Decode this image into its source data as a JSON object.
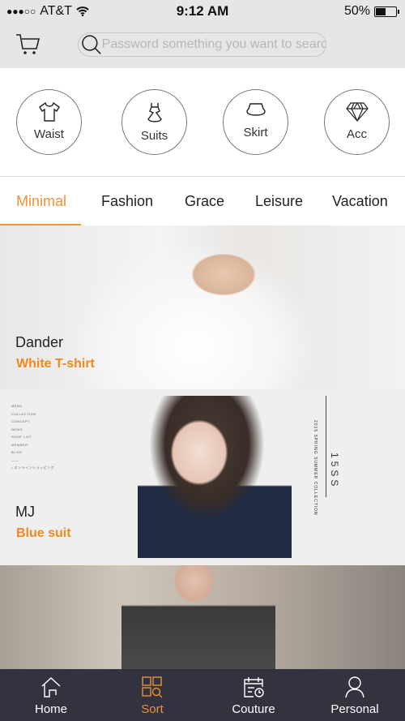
{
  "status_bar": {
    "signal": "●●●○○",
    "carrier": "AT&T",
    "time": "9:12 AM",
    "battery": "50%",
    "battery_level": 0.5
  },
  "header": {
    "search_placeholder": "Password something you want to search",
    "icons": [
      "cart-icon",
      "search-icon"
    ]
  },
  "categories": [
    {
      "label": "Waist",
      "icon": "tshirt-icon"
    },
    {
      "label": "Suits",
      "icon": "dress-icon"
    },
    {
      "label": "Skirt",
      "icon": "skirt-icon"
    },
    {
      "label": "Acc",
      "icon": "diamond-icon"
    }
  ],
  "tabs": [
    {
      "label": "Minimal",
      "active": true
    },
    {
      "label": "Fashion"
    },
    {
      "label": "Grace"
    },
    {
      "label": "Leisure"
    },
    {
      "label": "Vacation"
    }
  ],
  "banners": [
    {
      "title": "Dander",
      "subtitle": "White T-shirt"
    },
    {
      "title": "MJ",
      "subtitle": "Blue suit",
      "side_menu": [
        "MENU",
        "COLLECTION",
        "CONCEPT",
        "NEWS",
        "SHOP LIST",
        "MEMBER",
        "BLOG"
      ],
      "side_link": "• オンラインショッピング",
      "vertical_text": "2015 SPRING SUMMER COLLECTION",
      "collection_code": "15SS"
    },
    {}
  ],
  "bottom_nav": [
    {
      "label": "Home",
      "icon": "home-icon"
    },
    {
      "label": "Sort",
      "icon": "sort-icon",
      "active": true
    },
    {
      "label": "Couture",
      "icon": "calendar-icon"
    },
    {
      "label": "Personal",
      "icon": "person-icon"
    }
  ],
  "colors": {
    "accent": "#f08a1c",
    "nav_bg": "#33323f",
    "header_bg": "#e6e6e6"
  }
}
